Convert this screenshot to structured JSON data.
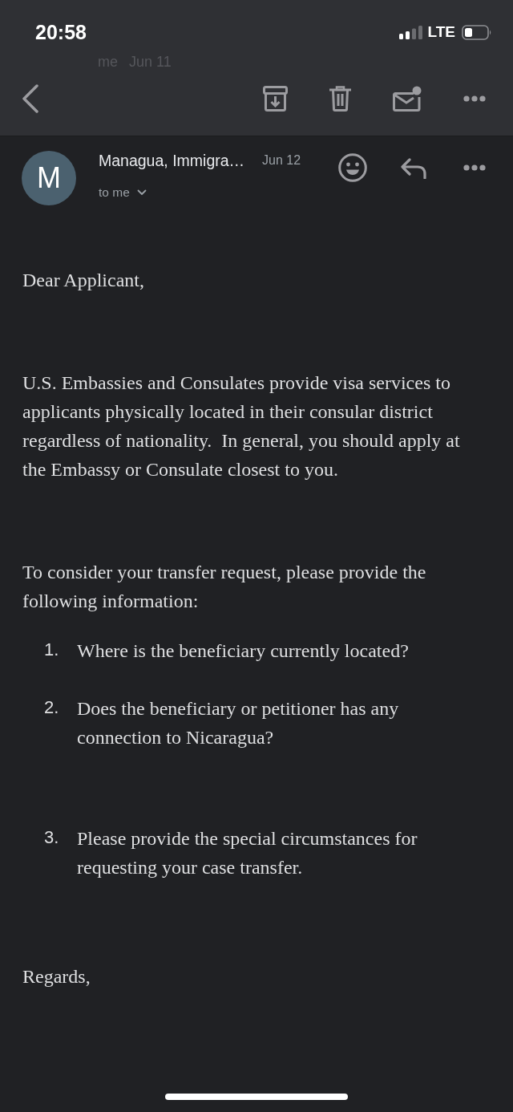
{
  "status_bar": {
    "time": "20:58",
    "network": "LTE"
  },
  "toolbar": {
    "previous_message": {
      "sender": "me",
      "date": "Jun 11"
    }
  },
  "message": {
    "avatar_letter": "M",
    "sender": "Managua, Immigra…",
    "date": "Jun 12",
    "recipient": "to me"
  },
  "body": {
    "greeting": "Dear Applicant,",
    "paragraphs": [
      "U.S. Embassies and Consulates provide visa services to applicants physically located in their consular district regardless of nationality.  In general, you should apply at the Embassy or Consulate closest to you.",
      "To consider your transfer request, please provide the following information:"
    ],
    "questions": [
      {
        "number": "1.",
        "text": "Where is the beneficiary currently located?"
      },
      {
        "number": "2.",
        "text": "Does the beneficiary or petitioner has any connection to Nicaragua?"
      },
      {
        "number": "3.",
        "text": "Please provide the special circumstances for requesting your case transfer."
      }
    ],
    "closing": "Regards,"
  }
}
